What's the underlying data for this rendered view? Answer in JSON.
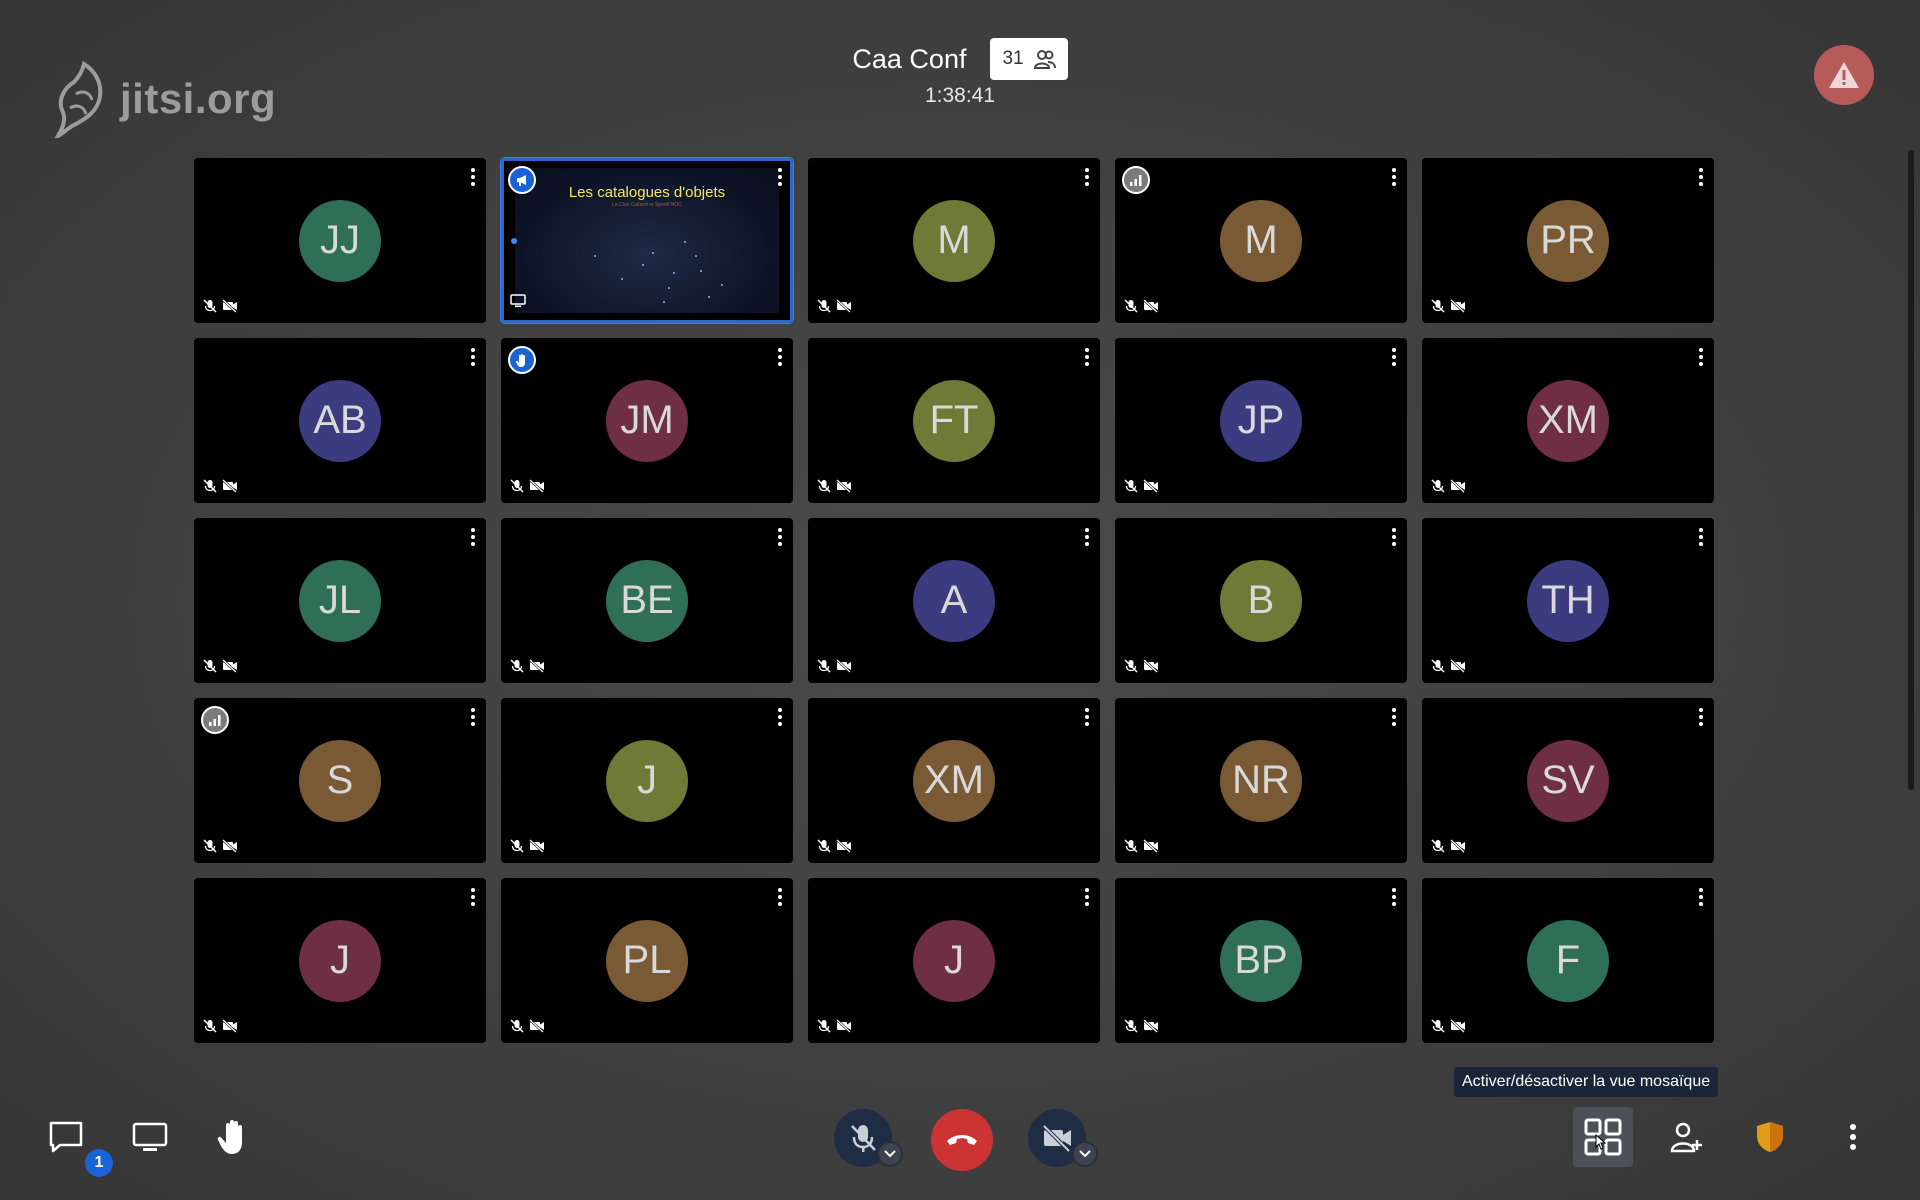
{
  "branding": {
    "logo_text": "jitsi.org"
  },
  "conference": {
    "name": "Caa Conf",
    "participant_count": "31",
    "timer": "1:38:41"
  },
  "colors": {
    "avatar_green": "#2f6e57",
    "avatar_olive": "#6e7a36",
    "avatar_brown": "#7a5a35",
    "avatar_indigo": "#3b3b80",
    "avatar_maroon": "#6e2e44",
    "accent_blue": "#1a63d6",
    "hangup_red": "#cc3333"
  },
  "tiles": [
    {
      "initials": "JJ",
      "color": "#2f6e57",
      "badge": ""
    },
    {
      "initials": "",
      "color": "",
      "badge": "megaphone",
      "screen_share": true,
      "share_title": "Les catalogues d'objets",
      "share_subtitle": "Le Club Culturel et Sportif NOC"
    },
    {
      "initials": "M",
      "color": "#6e7a36",
      "badge": ""
    },
    {
      "initials": "M",
      "color": "#7a5a35",
      "badge": "signal"
    },
    {
      "initials": "PR",
      "color": "#7a5a35",
      "badge": ""
    },
    {
      "initials": "AB",
      "color": "#3b3b80",
      "badge": ""
    },
    {
      "initials": "JM",
      "color": "#6e2e44",
      "badge": "hand"
    },
    {
      "initials": "FT",
      "color": "#6e7a36",
      "badge": ""
    },
    {
      "initials": "JP",
      "color": "#3b3b80",
      "badge": ""
    },
    {
      "initials": "XM",
      "color": "#6e2e44",
      "badge": ""
    },
    {
      "initials": "JL",
      "color": "#2f6e57",
      "badge": ""
    },
    {
      "initials": "BE",
      "color": "#2f6e57",
      "badge": ""
    },
    {
      "initials": "A",
      "color": "#3b3b80",
      "badge": ""
    },
    {
      "initials": "B",
      "color": "#6e7a36",
      "badge": ""
    },
    {
      "initials": "TH",
      "color": "#3b3b80",
      "badge": ""
    },
    {
      "initials": "S",
      "color": "#7a5a35",
      "badge": "signal"
    },
    {
      "initials": "J",
      "color": "#6e7a36",
      "badge": ""
    },
    {
      "initials": "XM",
      "color": "#7a5a35",
      "badge": ""
    },
    {
      "initials": "NR",
      "color": "#7a5a35",
      "badge": ""
    },
    {
      "initials": "SV",
      "color": "#6e2e44",
      "badge": ""
    },
    {
      "initials": "J",
      "color": "#6e2e44",
      "badge": ""
    },
    {
      "initials": "PL",
      "color": "#7a5a35",
      "badge": ""
    },
    {
      "initials": "J",
      "color": "#6e2e44",
      "badge": ""
    },
    {
      "initials": "BP",
      "color": "#2f6e57",
      "badge": ""
    },
    {
      "initials": "F",
      "color": "#2f6e57",
      "badge": ""
    }
  ],
  "tooltip": {
    "text": "Activer/désactiver la vue mosaïque"
  },
  "toolbar": {
    "chat_unread": "1",
    "left": [
      "chat-icon",
      "screen-share-icon",
      "raise-hand-icon"
    ],
    "center": [
      "microphone-muted-icon",
      "hangup-icon",
      "camera-muted-icon"
    ],
    "right": [
      "tile-view-icon",
      "invite-icon",
      "security-shield-icon",
      "more-options-icon"
    ]
  }
}
